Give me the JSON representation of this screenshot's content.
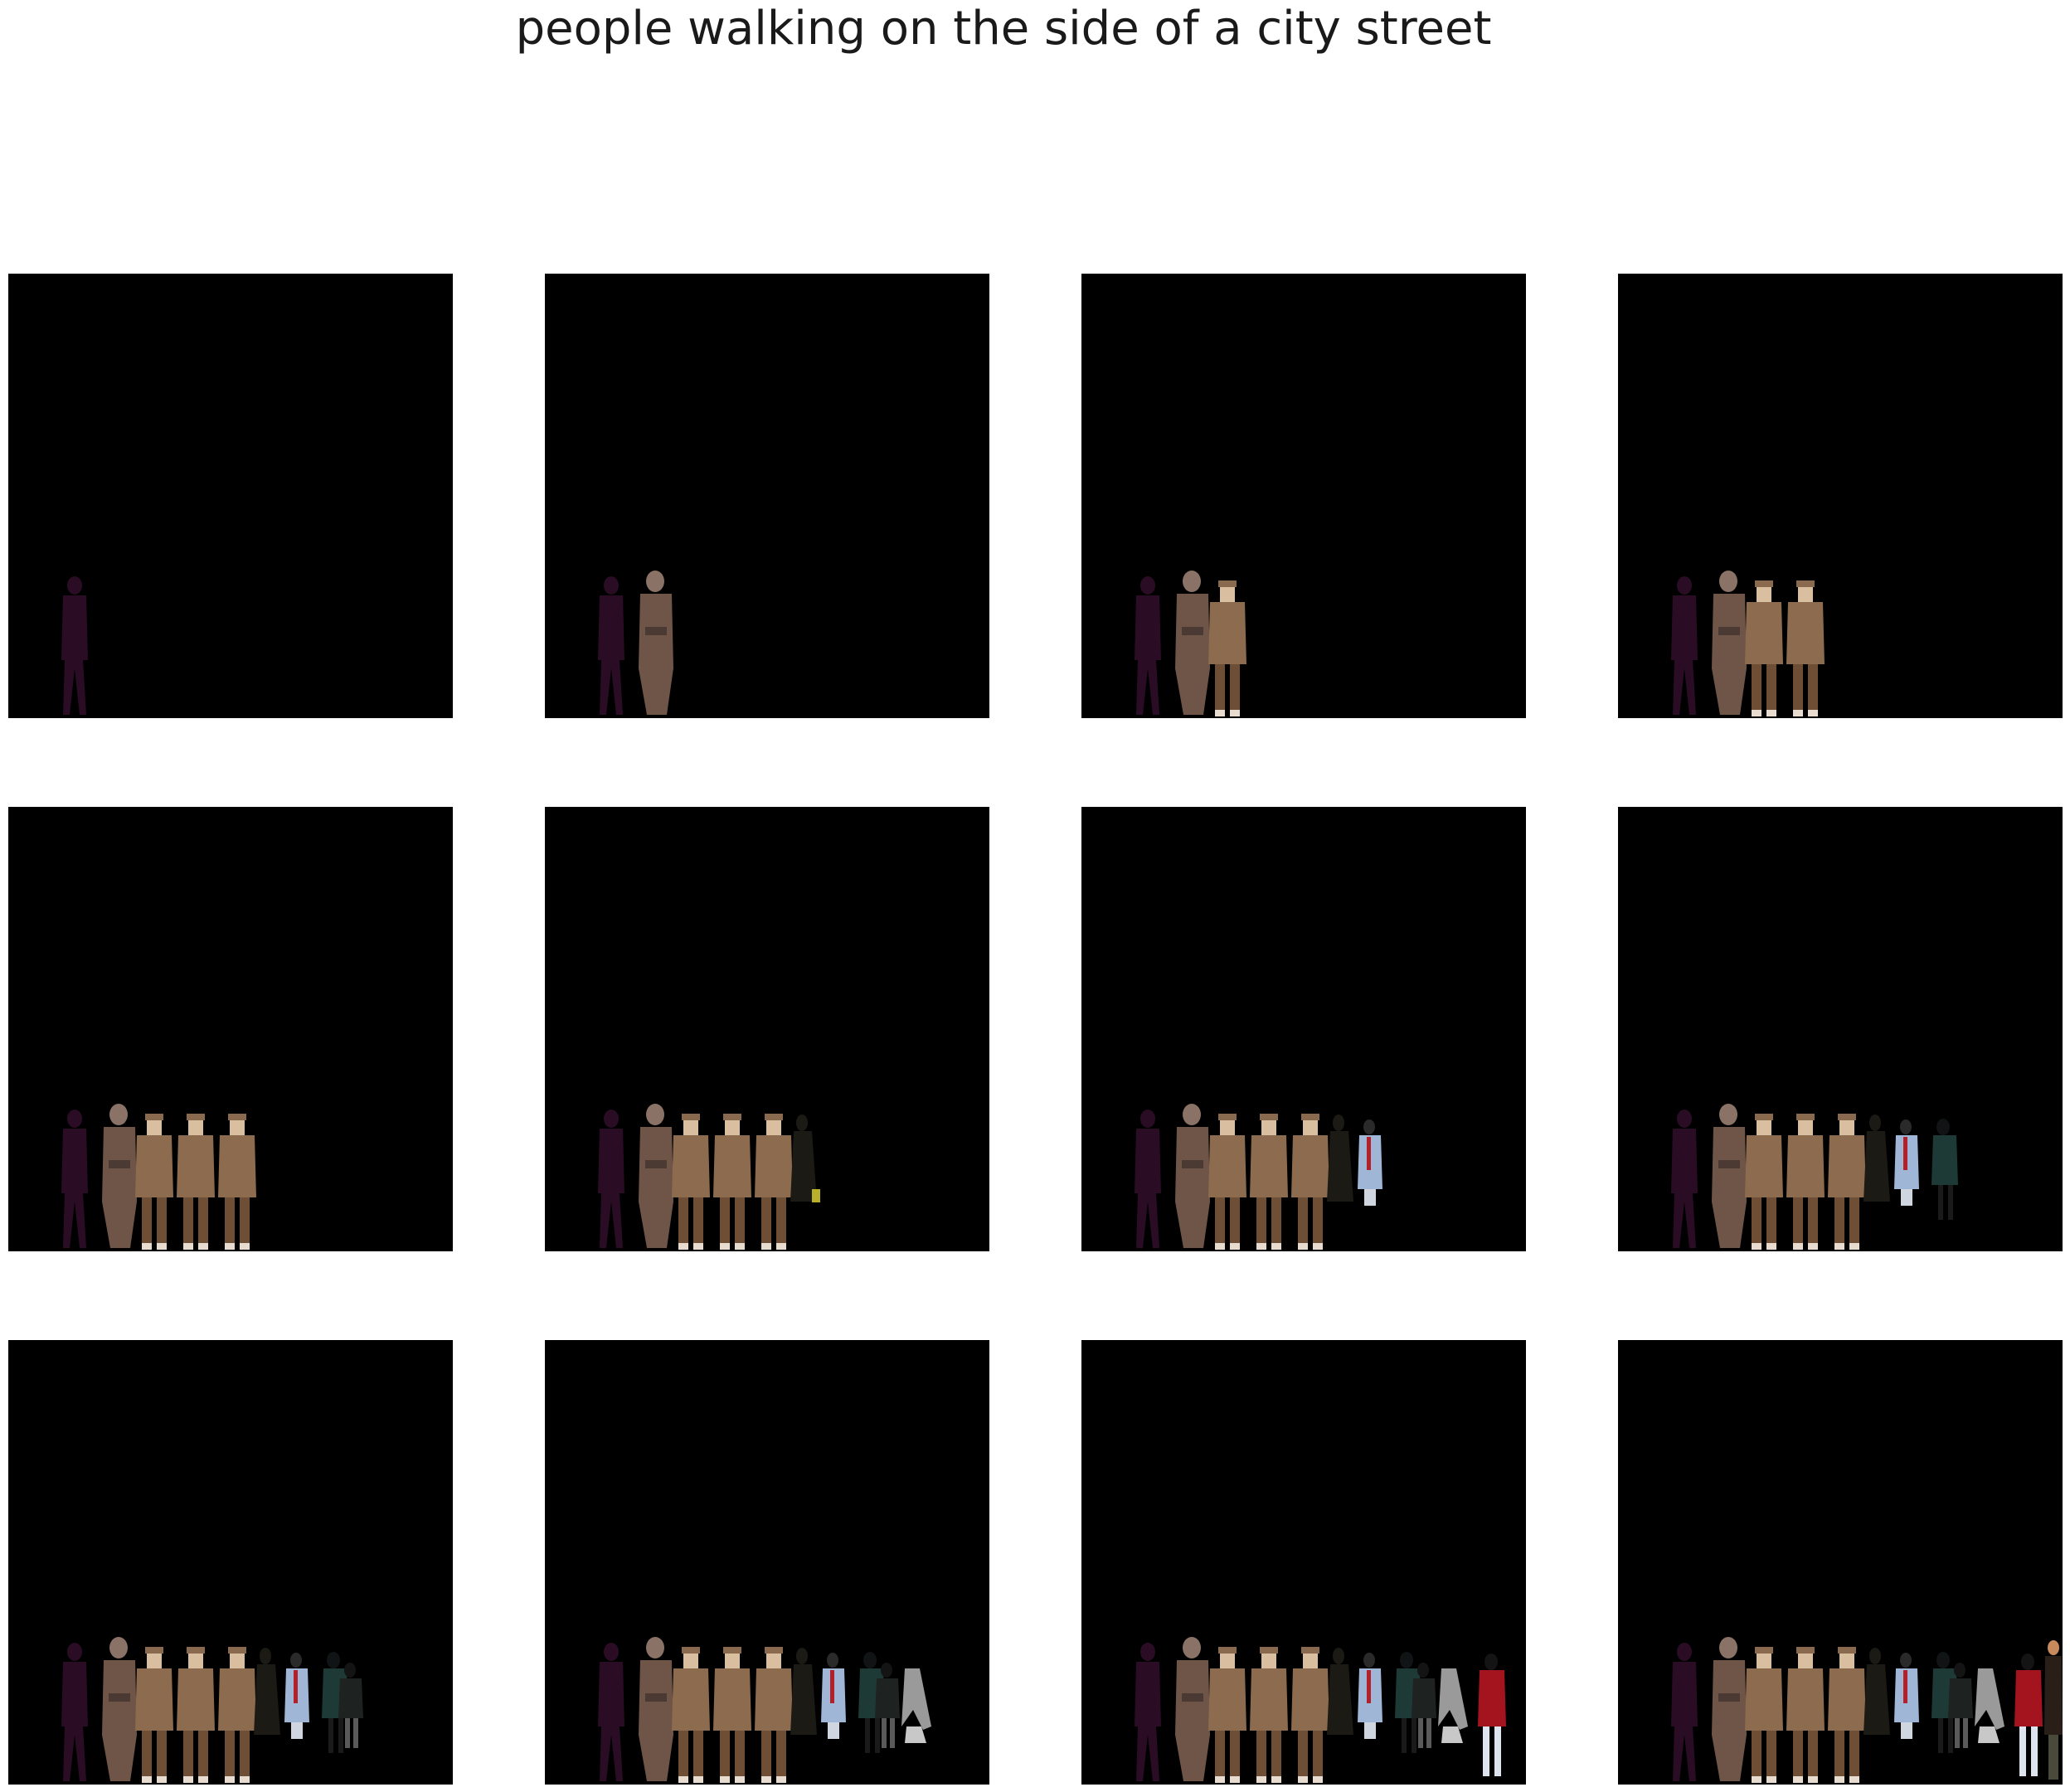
{
  "figure": {
    "title": "people walking on the side of a city street"
  },
  "panels": [
    {
      "index": 1,
      "figures": [
        "purple-walker"
      ]
    },
    {
      "index": 2,
      "figures": [
        "purple-walker",
        "old-man"
      ]
    },
    {
      "index": 3,
      "figures": [
        "purple-walker",
        "old-man",
        "boy"
      ]
    },
    {
      "index": 4,
      "figures": [
        "purple-walker",
        "old-man",
        "boy",
        "boy"
      ]
    },
    {
      "index": 5,
      "figures": [
        "purple-walker",
        "old-man",
        "boy",
        "boy",
        "boy"
      ]
    },
    {
      "index": 6,
      "figures": [
        "purple-walker",
        "old-man",
        "boy",
        "boy",
        "boy",
        "dark-woman-yellow"
      ]
    },
    {
      "index": 7,
      "figures": [
        "purple-walker",
        "old-man",
        "boy",
        "boy",
        "boy",
        "dark-woman",
        "light-blue-coat"
      ]
    },
    {
      "index": 8,
      "figures": [
        "purple-walker",
        "old-man",
        "boy",
        "boy",
        "boy",
        "dark-woman",
        "light-blue-coat",
        "teal-walker"
      ]
    },
    {
      "index": 9,
      "figures": [
        "purple-walker",
        "old-man",
        "boy",
        "boy",
        "boy",
        "dark-woman",
        "light-blue-coat",
        "teal-walker",
        "dark-walker"
      ]
    },
    {
      "index": 10,
      "figures": [
        "purple-walker",
        "old-man",
        "boy",
        "boy",
        "boy",
        "dark-woman",
        "light-blue-coat",
        "teal-walker",
        "dark-walker",
        "grey-figure"
      ]
    },
    {
      "index": 11,
      "figures": [
        "purple-walker",
        "old-man",
        "boy",
        "boy",
        "boy",
        "dark-woman",
        "light-blue-coat",
        "teal-walker",
        "dark-walker",
        "grey-figure",
        "red-coat"
      ]
    },
    {
      "index": 12,
      "figures": [
        "purple-walker",
        "old-man",
        "boy",
        "boy",
        "boy",
        "dark-woman",
        "light-blue-coat",
        "teal-walker",
        "dark-walker",
        "grey-figure",
        "red-coat",
        "edge-person"
      ]
    }
  ],
  "colors": {
    "background": "#ffffff",
    "panel": "#000000",
    "purple_walker": "#2a0d24",
    "old_man": "#6e5548",
    "boy_coat": "#8c6b4e",
    "boy_face": "#d9bfa0",
    "boy_pants": "#6e4f36",
    "dark_woman": "#1c1a14",
    "yellow_bag": "#b8b02a",
    "light_blue": "#9fb6d6",
    "red_accent": "#b3202a",
    "teal": "#1e3a36",
    "grey": "#9a9a9a",
    "red_coat": "#a3141e"
  }
}
